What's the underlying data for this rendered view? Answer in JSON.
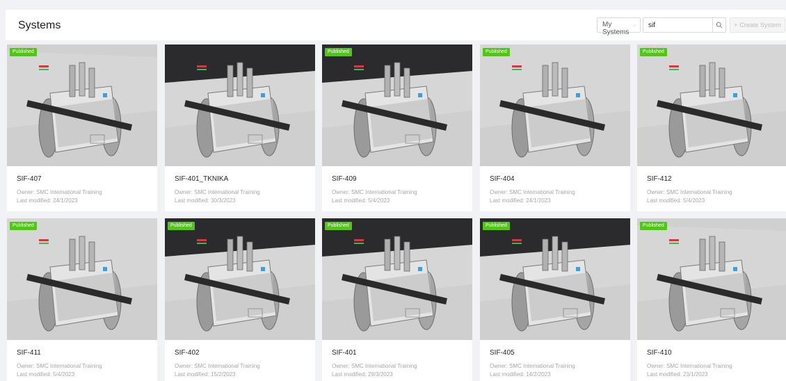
{
  "header": {
    "title": "Systems",
    "filter_value": "My Systems",
    "search_value": "sif",
    "create_label": "Create System"
  },
  "badge_label": "Published",
  "owner_prefix": "Owner:",
  "modified_prefix": "Last modified:",
  "systems": [
    {
      "name": "SIF-407",
      "owner": "Owner: SMC International Training",
      "modified": "Last modified: 24/1/2023",
      "published": true,
      "scene": "dark-floor"
    },
    {
      "name": "SIF-401_TKNIKA",
      "owner": "Owner: SMC International Training",
      "modified": "Last modified: 30/3/2023",
      "published": false,
      "scene": "dark-top"
    },
    {
      "name": "SIF-409",
      "owner": "Owner: SMC International Training",
      "modified": "Last modified: 5/4/2023",
      "published": true,
      "scene": "dark-top"
    },
    {
      "name": "SIF-404",
      "owner": "Owner: SMC International Training",
      "modified": "Last modified: 24/1/2023",
      "published": true,
      "scene": "light"
    },
    {
      "name": "SIF-412",
      "owner": "Owner: SMC International Training",
      "modified": "Last modified: 5/4/2023",
      "published": true,
      "scene": "light"
    },
    {
      "name": "SIF-411",
      "owner": "Owner: SMC International Training",
      "modified": "Last modified: 5/4/2023",
      "published": true,
      "scene": "light"
    },
    {
      "name": "SIF-402",
      "owner": "Owner: SMC International Training",
      "modified": "Last modified: 15/2/2023",
      "published": true,
      "scene": "dark-top"
    },
    {
      "name": "SIF-401",
      "owner": "Owner: SMC International Training",
      "modified": "Last modified: 29/3/2023",
      "published": true,
      "scene": "dark-top"
    },
    {
      "name": "SIF-405",
      "owner": "Owner: SMC International Training",
      "modified": "Last modified: 14/2/2023",
      "published": true,
      "scene": "dark-top"
    },
    {
      "name": "SIF-410",
      "owner": "Owner: SMC International Training",
      "modified": "Last modified: 23/1/2023",
      "published": true,
      "scene": "dark-floor"
    }
  ],
  "colors": {
    "badge": "#52c41a",
    "dark_scene": "#2b2b2e",
    "floor": "#dcdcdc"
  }
}
